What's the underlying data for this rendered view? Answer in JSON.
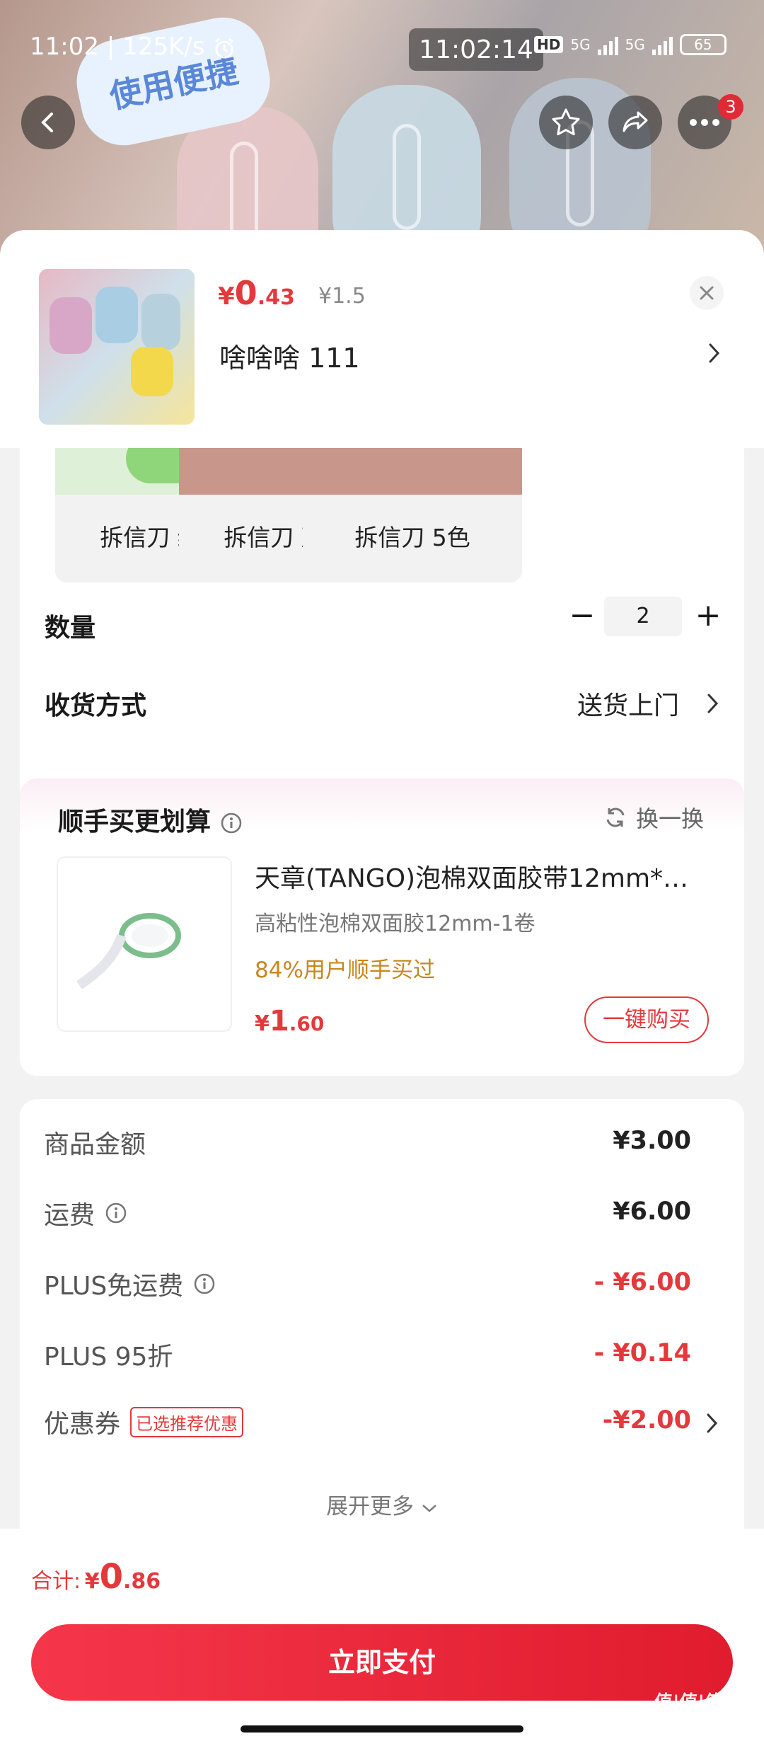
{
  "status_bar": {
    "time_left": "11:02",
    "net_speed": "125K/s",
    "clock": "11:02:14",
    "net1": "5G",
    "net2": "5G",
    "battery": "65"
  },
  "hero": {
    "bubble_text": "使用便捷",
    "cart_badge": "3"
  },
  "product": {
    "price_symbol": "¥",
    "price_int": "0",
    "price_dec": ".43",
    "price_original": "¥1.5",
    "spec": "啥啥啥  111"
  },
  "variants": [
    {
      "label": "拆信刀 绿色"
    },
    {
      "label": "拆信刀 蓝色"
    },
    {
      "label": "拆信刀 5色"
    }
  ],
  "quantity": {
    "label": "数量",
    "value": "2"
  },
  "shipping": {
    "label": "收货方式",
    "value": "送货上门"
  },
  "addon": {
    "title": "顺手买更划算",
    "swap_label": "换一换",
    "name": "天章(TANGO)泡棉双面胶带12mm*…",
    "sub": "高粘性泡棉双面胶12mm-1卷",
    "pct": "84%用户顺手买过",
    "price_symbol": "¥",
    "price_int": "1",
    "price_dec": ".60",
    "buy_label": "一键购买"
  },
  "summary": {
    "rows": [
      {
        "label": "商品金额",
        "value": "¥3.00"
      },
      {
        "label": "运费",
        "value": "¥6.00"
      },
      {
        "label": "PLUS免运费",
        "value": "- ¥6.00"
      },
      {
        "label": "PLUS 95折",
        "value": "- ¥0.14"
      },
      {
        "label": "优惠券",
        "tag": "已选推荐优惠",
        "value": "-¥2.00"
      }
    ],
    "expand": "展开更多"
  },
  "footer": {
    "total_label": "合计:",
    "total_symbol": "¥",
    "total_int": "0",
    "total_dec": ".86",
    "pay_label": "立即支付"
  },
  "watermark": "值|值|值",
  "colors": {
    "accent": "#e4393c",
    "addon_pct": "#c8871d"
  }
}
